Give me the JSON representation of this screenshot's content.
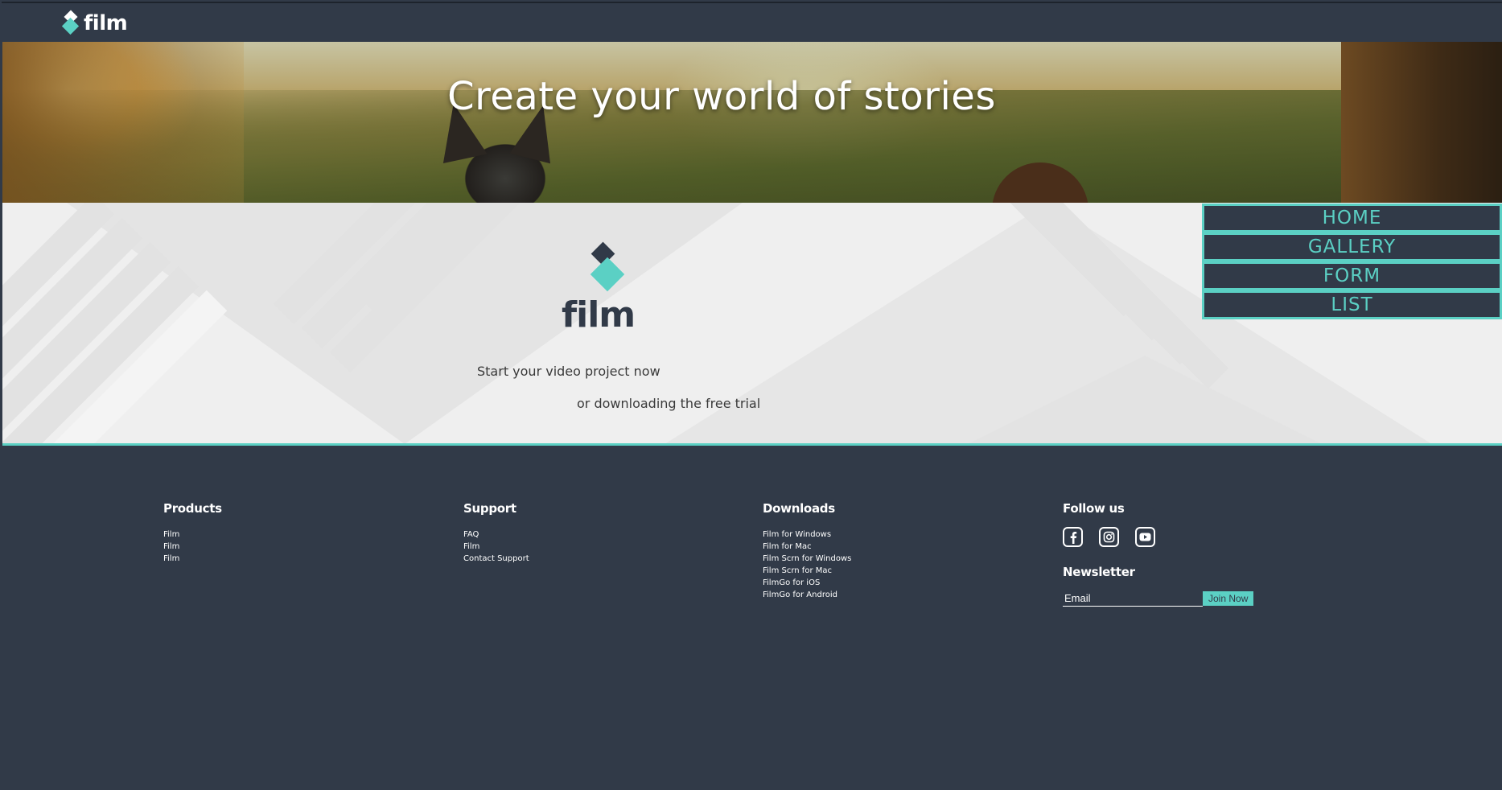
{
  "header": {
    "logo_text": "film"
  },
  "hero": {
    "title": "Create your world of stories"
  },
  "band": {
    "logo_text": "film",
    "tagline_line1": "Start your video project now",
    "tagline_line2": "or downloading the free trial"
  },
  "nav": {
    "items": [
      {
        "label": "HOME"
      },
      {
        "label": "GALLERY"
      },
      {
        "label": "FORM"
      },
      {
        "label": "LIST"
      }
    ]
  },
  "footer": {
    "products": {
      "heading": "Products",
      "links": [
        "Film",
        "Film",
        "Film"
      ]
    },
    "support": {
      "heading": "Support",
      "links": [
        "FAQ",
        "Film",
        "Contact Support"
      ]
    },
    "downloads": {
      "heading": "Downloads",
      "links": [
        "Film for Windows",
        "Film for Mac",
        "Film Scrn for Windows",
        "Film Scrn for Mac",
        "FilmGo for iOS",
        "FilmGo for Android"
      ]
    },
    "follow": {
      "heading": "Follow us",
      "icons": [
        "facebook-icon",
        "instagram-icon",
        "youtube-icon"
      ]
    },
    "newsletter": {
      "heading": "Newsletter",
      "email_placeholder": "Email",
      "join_label": "Join Now"
    }
  },
  "colors": {
    "dark": "#313a48",
    "accent": "#5bd0c4",
    "band_bg": "#efefef"
  }
}
